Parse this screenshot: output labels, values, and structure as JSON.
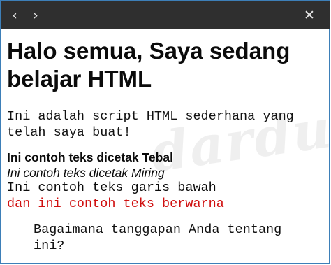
{
  "titlebar": {
    "back_icon": "chevron-left-icon",
    "forward_icon": "chevron-right-icon",
    "close_icon": "close-icon"
  },
  "page": {
    "heading": "Halo semua, Saya sedang belajar HTML",
    "intro": "Ini adalah script HTML sederhana yang telah saya buat!",
    "bold_text": "Ini contoh teks dicetak Tebal",
    "italic_text": "Ini contoh teks dicetak Miring",
    "underline_text": "Ini contoh teks garis bawah",
    "colored_text": "dan ini contoh teks berwarna",
    "question": "Bagaimana tanggapan Anda tentang ini?",
    "watermark": "dardura",
    "colored_text_color": "#d01010"
  }
}
